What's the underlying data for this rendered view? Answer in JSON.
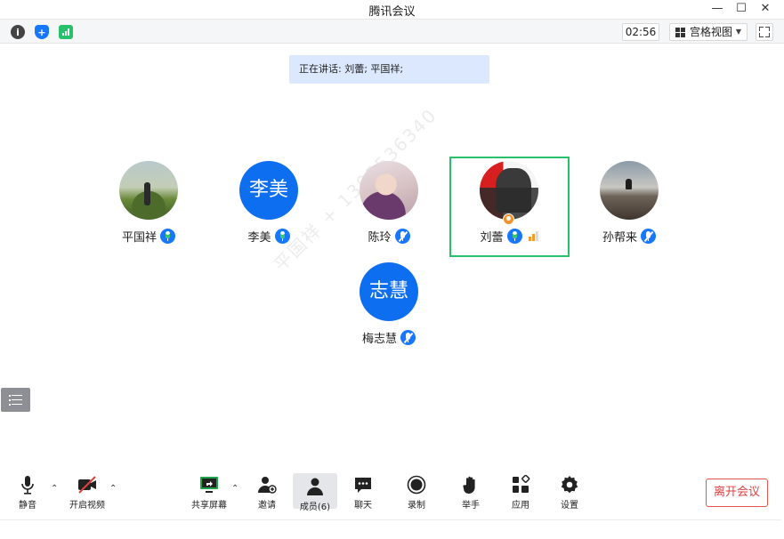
{
  "window": {
    "title": "腾讯会议",
    "minimize_glyph": "—",
    "maximize_glyph": "☐",
    "close_glyph": "✕"
  },
  "infobar": {
    "timer": "02:56",
    "view_mode": "宫格视图",
    "icons": [
      "info-icon",
      "shield-icon",
      "signal-strength-icon"
    ],
    "colors": {
      "info": "#444444",
      "shield": "#1677ff",
      "signal": "#26c16a"
    }
  },
  "speaking_banner": "正在讲话: 刘蕾; 平国祥;",
  "participants": [
    {
      "name": "平国祥",
      "avatar_type": "photo",
      "mic": "active"
    },
    {
      "name": "李美",
      "avatar_type": "letter",
      "avatar_text": "李美",
      "mic": "active"
    },
    {
      "name": "陈玲",
      "avatar_type": "photo",
      "mic": "muted"
    },
    {
      "name": "刘蕾",
      "avatar_type": "photo",
      "mic": "active",
      "is_host": true,
      "is_speaking_highlight": true,
      "signal_level": 2
    },
    {
      "name": "孙帮来",
      "avatar_type": "photo",
      "mic": "muted"
    },
    {
      "name": "梅志慧",
      "avatar_type": "letter",
      "avatar_text": "志慧",
      "mic": "muted"
    }
  ],
  "watermark": "平国祥 + 1395536340",
  "toolbar": {
    "mute_label": "静音",
    "video_label": "开启视频",
    "share_label": "共享屏幕",
    "invite_label": "邀请",
    "members_label": "成员(6)",
    "chat_label": "聊天",
    "record_label": "录制",
    "raise_hand_label": "举手",
    "apps_label": "应用",
    "settings_label": "设置",
    "leave_label": "离开会议"
  },
  "colors": {
    "accent": "#1677ff",
    "avatar_blue": "#0d6ef0",
    "active_frame": "#26c16a",
    "leave_red": "#e04040",
    "banner_bg": "#dbe8fd"
  }
}
